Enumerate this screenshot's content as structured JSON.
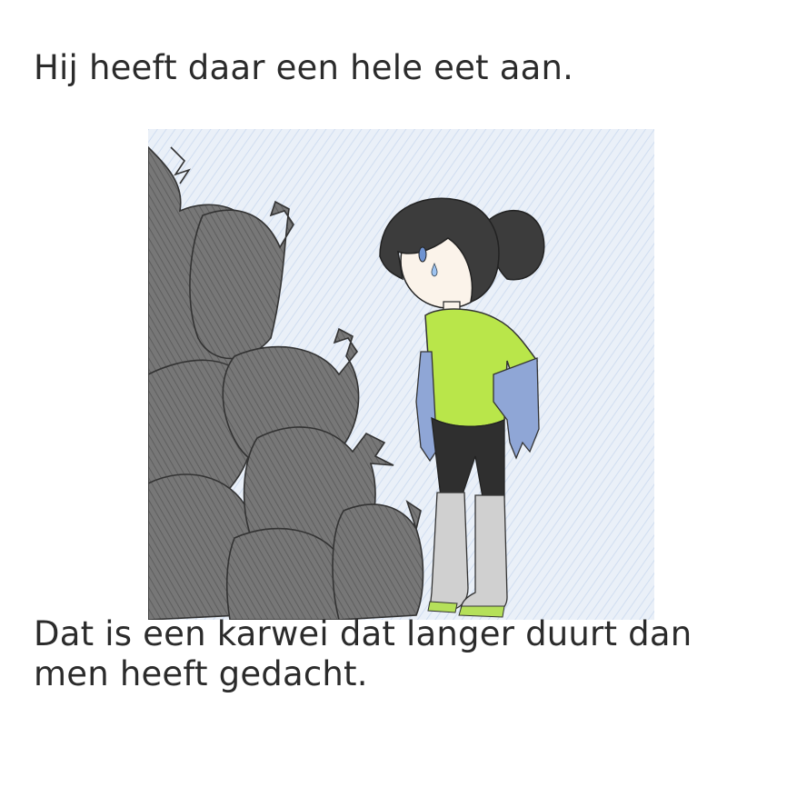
{
  "page": {
    "top_caption": "Hij heeft daar een hele eet aan.",
    "bottom_caption": "Dat is een karwei dat langer duurt dan men heeft gedacht."
  },
  "illustration": {
    "subject": "girl in green shirt, gloves and rubber boots looking at a pile of black garbage bags",
    "colors": {
      "background_wash": "#dfe8f4",
      "bags": "#6f6f6f",
      "bags_dark": "#4f4f4f",
      "shirt": "#b9e64a",
      "gloves": "#8fa6d6",
      "hair": "#3c3c3c",
      "shorts": "#2f2f2f",
      "boots": "#d0d0d0",
      "boot_soles": "#b5e05a",
      "skin": "#fbf3ea"
    }
  }
}
